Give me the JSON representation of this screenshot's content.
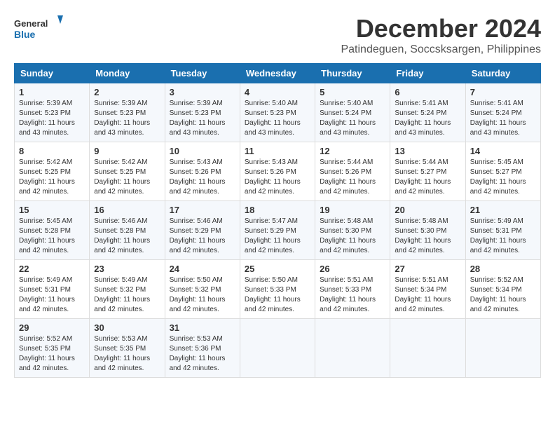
{
  "logo": {
    "line1": "General",
    "line2": "Blue"
  },
  "title": "December 2024",
  "location": "Patindeguen, Soccsksargen, Philippines",
  "days_of_week": [
    "Sunday",
    "Monday",
    "Tuesday",
    "Wednesday",
    "Thursday",
    "Friday",
    "Saturday"
  ],
  "weeks": [
    [
      {
        "day": "1",
        "info": "Sunrise: 5:39 AM\nSunset: 5:23 PM\nDaylight: 11 hours\nand 43 minutes."
      },
      {
        "day": "2",
        "info": "Sunrise: 5:39 AM\nSunset: 5:23 PM\nDaylight: 11 hours\nand 43 minutes."
      },
      {
        "day": "3",
        "info": "Sunrise: 5:39 AM\nSunset: 5:23 PM\nDaylight: 11 hours\nand 43 minutes."
      },
      {
        "day": "4",
        "info": "Sunrise: 5:40 AM\nSunset: 5:23 PM\nDaylight: 11 hours\nand 43 minutes."
      },
      {
        "day": "5",
        "info": "Sunrise: 5:40 AM\nSunset: 5:24 PM\nDaylight: 11 hours\nand 43 minutes."
      },
      {
        "day": "6",
        "info": "Sunrise: 5:41 AM\nSunset: 5:24 PM\nDaylight: 11 hours\nand 43 minutes."
      },
      {
        "day": "7",
        "info": "Sunrise: 5:41 AM\nSunset: 5:24 PM\nDaylight: 11 hours\nand 43 minutes."
      }
    ],
    [
      {
        "day": "8",
        "info": "Sunrise: 5:42 AM\nSunset: 5:25 PM\nDaylight: 11 hours\nand 42 minutes."
      },
      {
        "day": "9",
        "info": "Sunrise: 5:42 AM\nSunset: 5:25 PM\nDaylight: 11 hours\nand 42 minutes."
      },
      {
        "day": "10",
        "info": "Sunrise: 5:43 AM\nSunset: 5:26 PM\nDaylight: 11 hours\nand 42 minutes."
      },
      {
        "day": "11",
        "info": "Sunrise: 5:43 AM\nSunset: 5:26 PM\nDaylight: 11 hours\nand 42 minutes."
      },
      {
        "day": "12",
        "info": "Sunrise: 5:44 AM\nSunset: 5:26 PM\nDaylight: 11 hours\nand 42 minutes."
      },
      {
        "day": "13",
        "info": "Sunrise: 5:44 AM\nSunset: 5:27 PM\nDaylight: 11 hours\nand 42 minutes."
      },
      {
        "day": "14",
        "info": "Sunrise: 5:45 AM\nSunset: 5:27 PM\nDaylight: 11 hours\nand 42 minutes."
      }
    ],
    [
      {
        "day": "15",
        "info": "Sunrise: 5:45 AM\nSunset: 5:28 PM\nDaylight: 11 hours\nand 42 minutes."
      },
      {
        "day": "16",
        "info": "Sunrise: 5:46 AM\nSunset: 5:28 PM\nDaylight: 11 hours\nand 42 minutes."
      },
      {
        "day": "17",
        "info": "Sunrise: 5:46 AM\nSunset: 5:29 PM\nDaylight: 11 hours\nand 42 minutes."
      },
      {
        "day": "18",
        "info": "Sunrise: 5:47 AM\nSunset: 5:29 PM\nDaylight: 11 hours\nand 42 minutes."
      },
      {
        "day": "19",
        "info": "Sunrise: 5:48 AM\nSunset: 5:30 PM\nDaylight: 11 hours\nand 42 minutes."
      },
      {
        "day": "20",
        "info": "Sunrise: 5:48 AM\nSunset: 5:30 PM\nDaylight: 11 hours\nand 42 minutes."
      },
      {
        "day": "21",
        "info": "Sunrise: 5:49 AM\nSunset: 5:31 PM\nDaylight: 11 hours\nand 42 minutes."
      }
    ],
    [
      {
        "day": "22",
        "info": "Sunrise: 5:49 AM\nSunset: 5:31 PM\nDaylight: 11 hours\nand 42 minutes."
      },
      {
        "day": "23",
        "info": "Sunrise: 5:49 AM\nSunset: 5:32 PM\nDaylight: 11 hours\nand 42 minutes."
      },
      {
        "day": "24",
        "info": "Sunrise: 5:50 AM\nSunset: 5:32 PM\nDaylight: 11 hours\nand 42 minutes."
      },
      {
        "day": "25",
        "info": "Sunrise: 5:50 AM\nSunset: 5:33 PM\nDaylight: 11 hours\nand 42 minutes."
      },
      {
        "day": "26",
        "info": "Sunrise: 5:51 AM\nSunset: 5:33 PM\nDaylight: 11 hours\nand 42 minutes."
      },
      {
        "day": "27",
        "info": "Sunrise: 5:51 AM\nSunset: 5:34 PM\nDaylight: 11 hours\nand 42 minutes."
      },
      {
        "day": "28",
        "info": "Sunrise: 5:52 AM\nSunset: 5:34 PM\nDaylight: 11 hours\nand 42 minutes."
      }
    ],
    [
      {
        "day": "29",
        "info": "Sunrise: 5:52 AM\nSunset: 5:35 PM\nDaylight: 11 hours\nand 42 minutes."
      },
      {
        "day": "30",
        "info": "Sunrise: 5:53 AM\nSunset: 5:35 PM\nDaylight: 11 hours\nand 42 minutes."
      },
      {
        "day": "31",
        "info": "Sunrise: 5:53 AM\nSunset: 5:36 PM\nDaylight: 11 hours\nand 42 minutes."
      },
      {
        "day": "",
        "info": ""
      },
      {
        "day": "",
        "info": ""
      },
      {
        "day": "",
        "info": ""
      },
      {
        "day": "",
        "info": ""
      }
    ]
  ]
}
